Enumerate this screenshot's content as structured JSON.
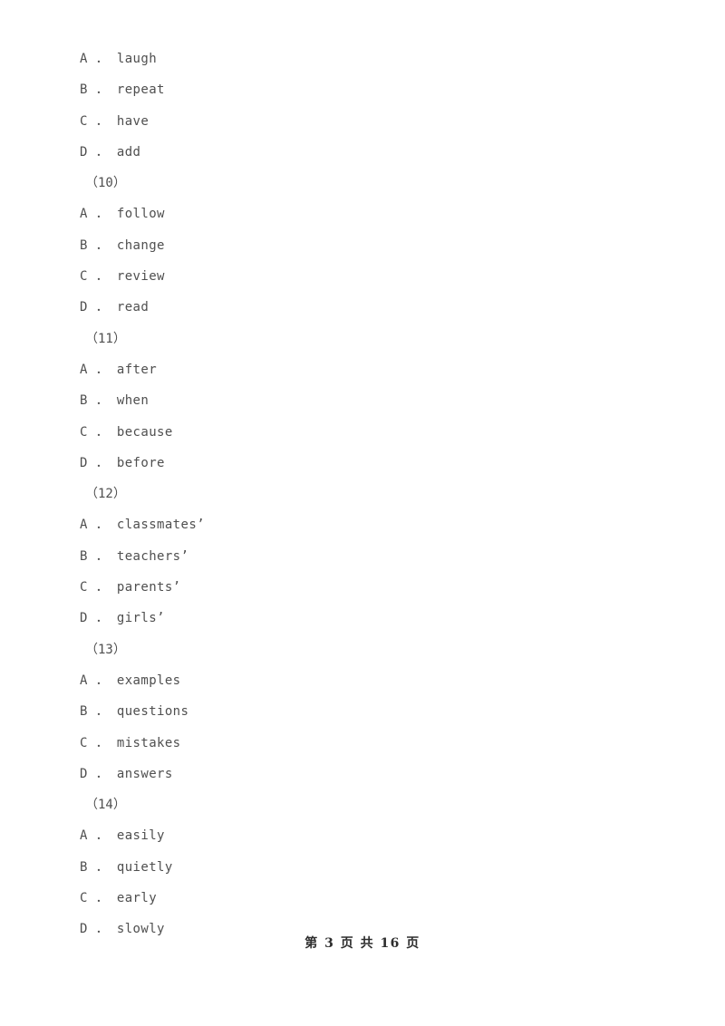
{
  "document": {
    "background_color": "#ffffff",
    "text_color": "#4f4f4f",
    "footer_color": "#2d2d2d"
  },
  "lines": [
    {
      "kind": "option",
      "text": "A ． laugh"
    },
    {
      "kind": "option",
      "text": "B ． repeat"
    },
    {
      "kind": "option",
      "text": "C ． have"
    },
    {
      "kind": "option",
      "text": "D ． add"
    },
    {
      "kind": "question",
      "text": "（10）"
    },
    {
      "kind": "option",
      "text": "A ． follow"
    },
    {
      "kind": "option",
      "text": "B ． change"
    },
    {
      "kind": "option",
      "text": "C ． review"
    },
    {
      "kind": "option",
      "text": "D ． read"
    },
    {
      "kind": "question",
      "text": "（11）"
    },
    {
      "kind": "option",
      "text": "A ． after"
    },
    {
      "kind": "option",
      "text": "B ． when"
    },
    {
      "kind": "option",
      "text": "C ． because"
    },
    {
      "kind": "option",
      "text": "D ． before"
    },
    {
      "kind": "question",
      "text": "（12）"
    },
    {
      "kind": "option",
      "text": "A ． classmates’"
    },
    {
      "kind": "option",
      "text": "B ． teachers’"
    },
    {
      "kind": "option",
      "text": "C ． parents’"
    },
    {
      "kind": "option",
      "text": "D ． girls’"
    },
    {
      "kind": "question",
      "text": "（13）"
    },
    {
      "kind": "option",
      "text": "A ． examples"
    },
    {
      "kind": "option",
      "text": "B ． questions"
    },
    {
      "kind": "option",
      "text": "C ． mistakes"
    },
    {
      "kind": "option",
      "text": "D ． answers"
    },
    {
      "kind": "question",
      "text": "（14）"
    },
    {
      "kind": "option",
      "text": "A ． easily"
    },
    {
      "kind": "option",
      "text": "B ． quietly"
    },
    {
      "kind": "option",
      "text": "C ． early"
    },
    {
      "kind": "option",
      "text": "D ． slowly"
    }
  ],
  "footer": {
    "text": "第 3 页 共 16 页",
    "current_page": "3",
    "total_pages": "16"
  }
}
